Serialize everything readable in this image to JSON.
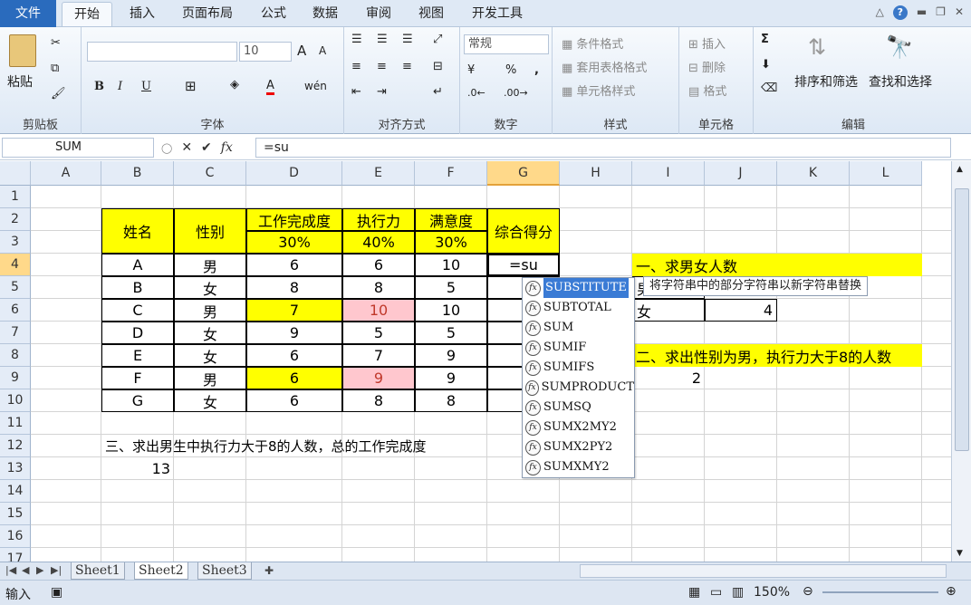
{
  "tabs": {
    "file": "文件",
    "home": "开始",
    "insert": "插入",
    "layout": "页面布局",
    "formulas": "公式",
    "data": "数据",
    "review": "审阅",
    "view": "视图",
    "developer": "开发工具"
  },
  "ribbon": {
    "clipboard": {
      "label": "剪贴板",
      "paste": "粘贴"
    },
    "font": {
      "label": "字体",
      "size": "10",
      "bold": "B",
      "italic": "I",
      "underline": "U",
      "wen": "wén",
      "font_color": "A",
      "font_grow": "A",
      "font_shrink": "A"
    },
    "alignment": {
      "label": "对齐方式"
    },
    "number": {
      "label": "数字",
      "format": "常规",
      "percent": "%",
      "comma": ","
    },
    "styles": {
      "label": "样式",
      "conditional": "条件格式",
      "table": "套用表格格式",
      "cell": "单元格样式"
    },
    "cells": {
      "label": "单元格",
      "insert": "插入",
      "delete": "删除",
      "format": "格式"
    },
    "editing": {
      "label": "编辑",
      "sort": "排序和筛选",
      "find": "查找和选择",
      "sum": "Σ"
    }
  },
  "formula_bar": {
    "name_box": "SUM",
    "fx": "fx",
    "cancel": "✕",
    "enter": "✔",
    "formula": "=su"
  },
  "columns": [
    "A",
    "B",
    "C",
    "D",
    "E",
    "F",
    "G",
    "H",
    "I",
    "J",
    "K",
    "L"
  ],
  "rows": [
    "1",
    "2",
    "3",
    "4",
    "5",
    "6",
    "7",
    "8",
    "9",
    "10",
    "11",
    "12",
    "13",
    "14",
    "15",
    "16",
    "17"
  ],
  "table": {
    "h_name": "姓名",
    "h_sex": "性别",
    "h_work": "工作完成度",
    "h_exec": "执行力",
    "h_sat": "满意度",
    "h_total": "综合得分",
    "w_work": "30%",
    "w_exec": "40%",
    "w_sat": "30%",
    "rows": [
      {
        "name": "A",
        "sex": "男",
        "work": "6",
        "exec": "6",
        "sat": "10"
      },
      {
        "name": "B",
        "sex": "女",
        "work": "8",
        "exec": "8",
        "sat": "5"
      },
      {
        "name": "C",
        "sex": "男",
        "work": "7",
        "exec": "10",
        "sat": "10"
      },
      {
        "name": "D",
        "sex": "女",
        "work": "9",
        "exec": "5",
        "sat": "5"
      },
      {
        "name": "E",
        "sex": "女",
        "work": "6",
        "exec": "7",
        "sat": "9"
      },
      {
        "name": "F",
        "sex": "男",
        "work": "6",
        "exec": "9",
        "sat": "9"
      },
      {
        "name": "G",
        "sex": "女",
        "work": "6",
        "exec": "8",
        "sat": "8"
      }
    ],
    "editing": "=su"
  },
  "notes": {
    "q1": "一、求男女人数",
    "q1_male": "男",
    "q1_female": "女",
    "q1_female_count": "4",
    "q2": "二、求出性别为男，执行力大于8的人数",
    "q2_answer": "2",
    "q3": "三、求出男生中执行力大于8的人数，总的工作完成度",
    "q3_answer": "13"
  },
  "autocomplete": {
    "items": [
      "SUBSTITUTE",
      "SUBTOTAL",
      "SUM",
      "SUMIF",
      "SUMIFS",
      "SUMPRODUCT",
      "SUMSQ",
      "SUMX2MY2",
      "SUMX2PY2",
      "SUMXMY2"
    ],
    "fx_glyph": "fx",
    "tooltip": "将字符串中的部分字符串以新字符串替换"
  },
  "sheets": [
    "Sheet1",
    "Sheet2",
    "Sheet3"
  ],
  "status": {
    "mode": "输入",
    "zoom": "150%"
  }
}
